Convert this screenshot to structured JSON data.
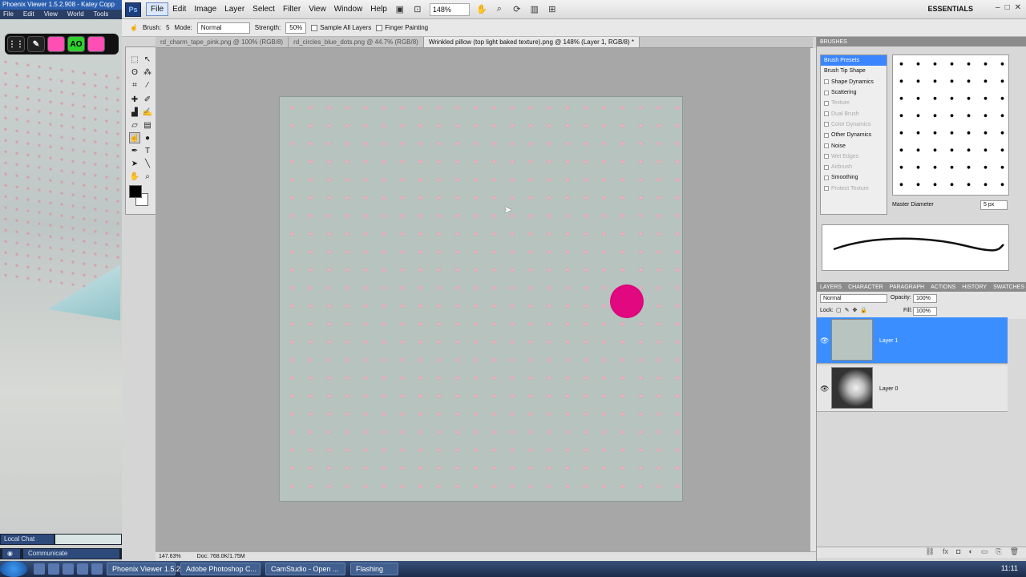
{
  "phoenix": {
    "title": "Phoenix Viewer 1.5.2.908 - Katey Copp",
    "menu": [
      "File",
      "Edit",
      "View",
      "World",
      "Tools"
    ],
    "tool_labels": [
      "AO"
    ],
    "local_chat": "Local Chat",
    "communicate": "Communicate"
  },
  "photoshop": {
    "logo": "Ps",
    "menu": [
      "File",
      "Edit",
      "Image",
      "Layer",
      "Select",
      "Filter",
      "View",
      "Window",
      "Help"
    ],
    "zoom": "148%",
    "essentials": "ESSENTIALS",
    "options": {
      "brush_label": "Brush:",
      "brush_size": "5",
      "mode_label": "Mode:",
      "mode_value": "Normal",
      "strength_label": "Strength:",
      "strength_value": "50%",
      "sample_all": "Sample All Layers",
      "finger_painting": "Finger Painting"
    },
    "doc_tabs": [
      "rd_charm_tape_pink.png @ 100% (RGB/8)",
      "rd_circles_blue_dots.png @ 44.7% (RGB/8)",
      "Wrinkled pillow (top light baked texture).png @ 148% (Layer 1, RGB/8) *"
    ],
    "status_zoom": "147.63%",
    "status_doc": "Doc: 768.0K/1.75M"
  },
  "brushes_panel": {
    "title": "BRUSHES",
    "items": [
      {
        "label": "Brush Presets",
        "state": "selected"
      },
      {
        "label": "Brush Tip Shape",
        "state": "normal"
      },
      {
        "label": "Shape Dynamics",
        "state": "normal"
      },
      {
        "label": "Scattering",
        "state": "normal"
      },
      {
        "label": "Texture",
        "state": "disabled"
      },
      {
        "label": "Dual Brush",
        "state": "disabled"
      },
      {
        "label": "Color Dynamics",
        "state": "disabled"
      },
      {
        "label": "Other Dynamics",
        "state": "normal"
      },
      {
        "label": "Noise",
        "state": "normal"
      },
      {
        "label": "Wet Edges",
        "state": "disabled"
      },
      {
        "label": "Airbrush",
        "state": "disabled"
      },
      {
        "label": "Smoothing",
        "state": "normal"
      },
      {
        "label": "Protect Texture",
        "state": "disabled"
      }
    ],
    "master_diameter_label": "Master Diameter",
    "master_diameter_value": "5 px"
  },
  "layers_panel": {
    "tabs": [
      "LAYERS",
      "CHARACTER",
      "PARAGRAPH",
      "ACTIONS",
      "HISTORY",
      "SWATCHES"
    ],
    "blend_mode": "Normal",
    "opacity_label": "Opacity:",
    "opacity_value": "100%",
    "lock_label": "Lock:",
    "fill_label": "Fill:",
    "fill_value": "100%",
    "layers": [
      {
        "name": "Layer 1",
        "selected": true
      },
      {
        "name": "Layer 0",
        "selected": false
      }
    ]
  },
  "taskbar": {
    "tasks": [
      "Phoenix Viewer 1.5.2...",
      "Adobe Photoshop C...",
      "CamStudio - Open ...",
      "Flashing"
    ],
    "clock": "11:11"
  },
  "colors": {
    "brush_dot": "#e2087f",
    "selection_blue": "#3b8eff",
    "canvas_base": "#b6c3bf"
  }
}
